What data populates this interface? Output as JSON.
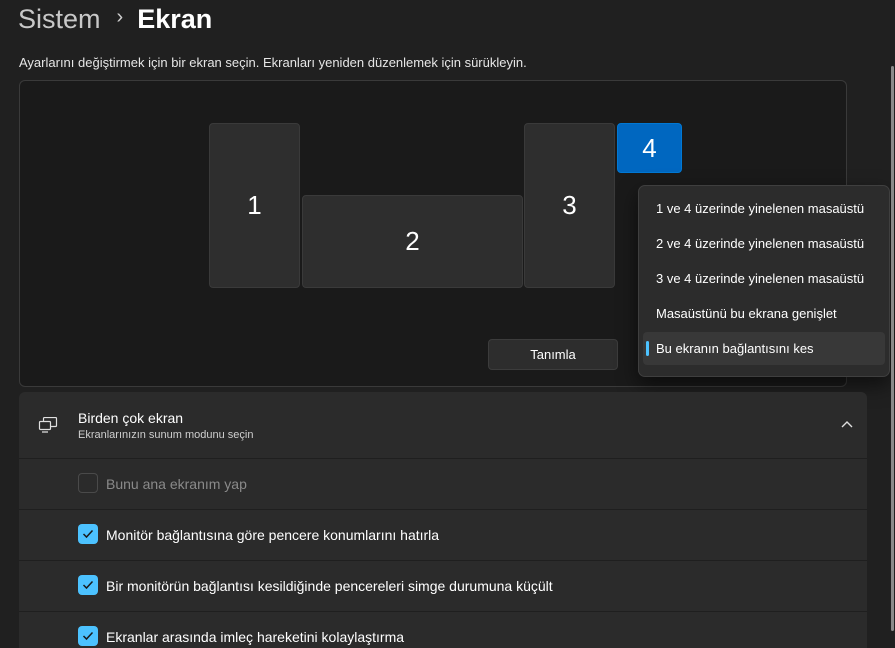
{
  "breadcrumb": {
    "parent": "Sistem",
    "separator": "›",
    "current": "Ekran"
  },
  "instruction": "Ayarlarını değiştirmek için bir ekran seçin. Ekranları yeniden düzenlemek için sürükleyin.",
  "arrangement": {
    "monitors": [
      {
        "label": "1",
        "selected": false
      },
      {
        "label": "2",
        "selected": false
      },
      {
        "label": "3",
        "selected": false
      },
      {
        "label": "4",
        "selected": true
      }
    ],
    "identify_label": "Tanımla"
  },
  "dropdown": {
    "items": [
      {
        "label": "1 ve 4 üzerinde yinelenen masaüstü",
        "selected": false
      },
      {
        "label": "2 ve 4 üzerinde yinelenen masaüstü",
        "selected": false
      },
      {
        "label": "3 ve 4 üzerinde yinelenen masaüstü",
        "selected": false
      },
      {
        "label": "Masaüstünü bu ekrana genişlet",
        "selected": false
      },
      {
        "label": "Bu ekranın bağlantısını kes",
        "selected": true
      }
    ]
  },
  "multi_display": {
    "title": "Birden çok ekran",
    "subtitle": "Ekranlarınızın sunum modunu seçin",
    "icon": "multi-monitor-icon",
    "expanded": true,
    "options": [
      {
        "label": "Bunu ana ekranım yap",
        "checked": false,
        "disabled": true
      },
      {
        "label": "Monitör bağlantısına göre pencere konumlarını hatırla",
        "checked": true,
        "disabled": false
      },
      {
        "label": "Bir monitörün bağlantısı kesildiğinde pencereleri simge durumuna küçült",
        "checked": true,
        "disabled": false
      },
      {
        "label": "Ekranlar arasında imleç hareketini kolaylaştırma",
        "checked": true,
        "disabled": false
      }
    ]
  },
  "colors": {
    "background": "#202020",
    "accent": "#0067c0",
    "checkbox_accent": "#4cc2ff"
  }
}
